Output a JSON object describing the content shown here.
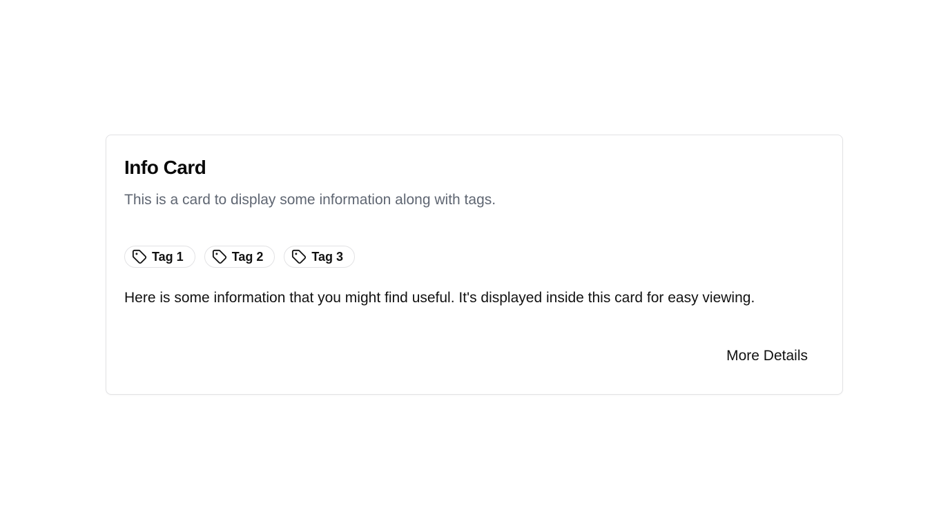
{
  "card": {
    "title": "Info Card",
    "subtitle": "This is a card to display some information along with tags.",
    "tags": [
      {
        "label": "Tag 1",
        "icon": "tag-icon"
      },
      {
        "label": "Tag 2",
        "icon": "tag-icon"
      },
      {
        "label": "Tag 3",
        "icon": "tag-icon"
      }
    ],
    "body": "Here is some information that you might find useful. It's displayed inside this card for easy viewing.",
    "action_label": "More Details"
  },
  "colors": {
    "border": "#e2e2e4",
    "subtitle_text": "#5f6672",
    "primary_text": "#111111"
  }
}
